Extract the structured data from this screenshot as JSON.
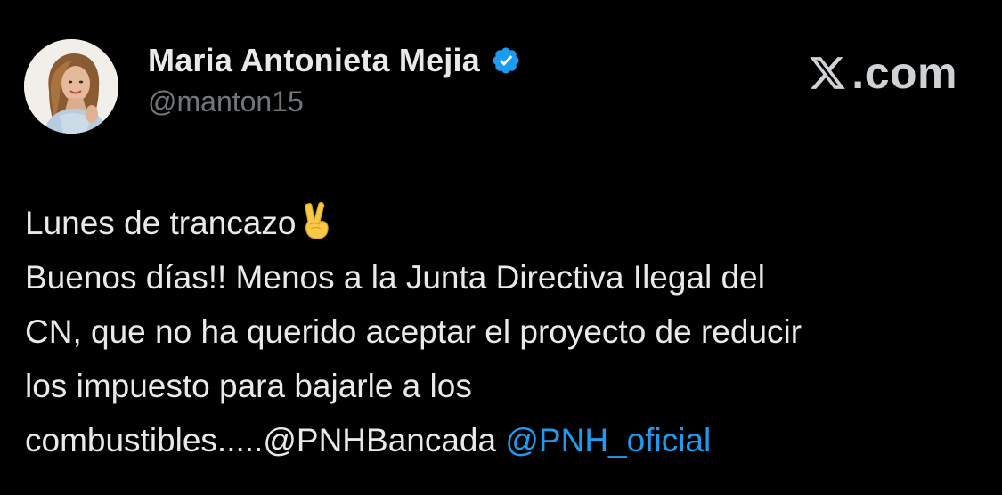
{
  "author": {
    "display_name": "Maria Antonieta Mejia",
    "handle": "@manton15",
    "verified": true,
    "avatar_icon": "profile-photo"
  },
  "brand": {
    "icon": "x-logo-icon",
    "text": ".com"
  },
  "tweet": {
    "line1": "Lunes de trancazo",
    "line1_emoji": "victory-hand-emoji",
    "line2": "Buenos días!! Menos a la Junta Directiva Ilegal del",
    "line3": "CN, que no ha querido aceptar el proyecto de reducir",
    "line4": "los impuesto para bajarle a los",
    "line5_text": "combustibles.....",
    "mention1": "@PNHBancada",
    "mention2": "@PNH_oficial"
  },
  "colors": {
    "background": "#000000",
    "text": "#e7e9ea",
    "secondary": "#71767b",
    "link": "#1d9bf0",
    "verified": "#1d9bf0"
  }
}
